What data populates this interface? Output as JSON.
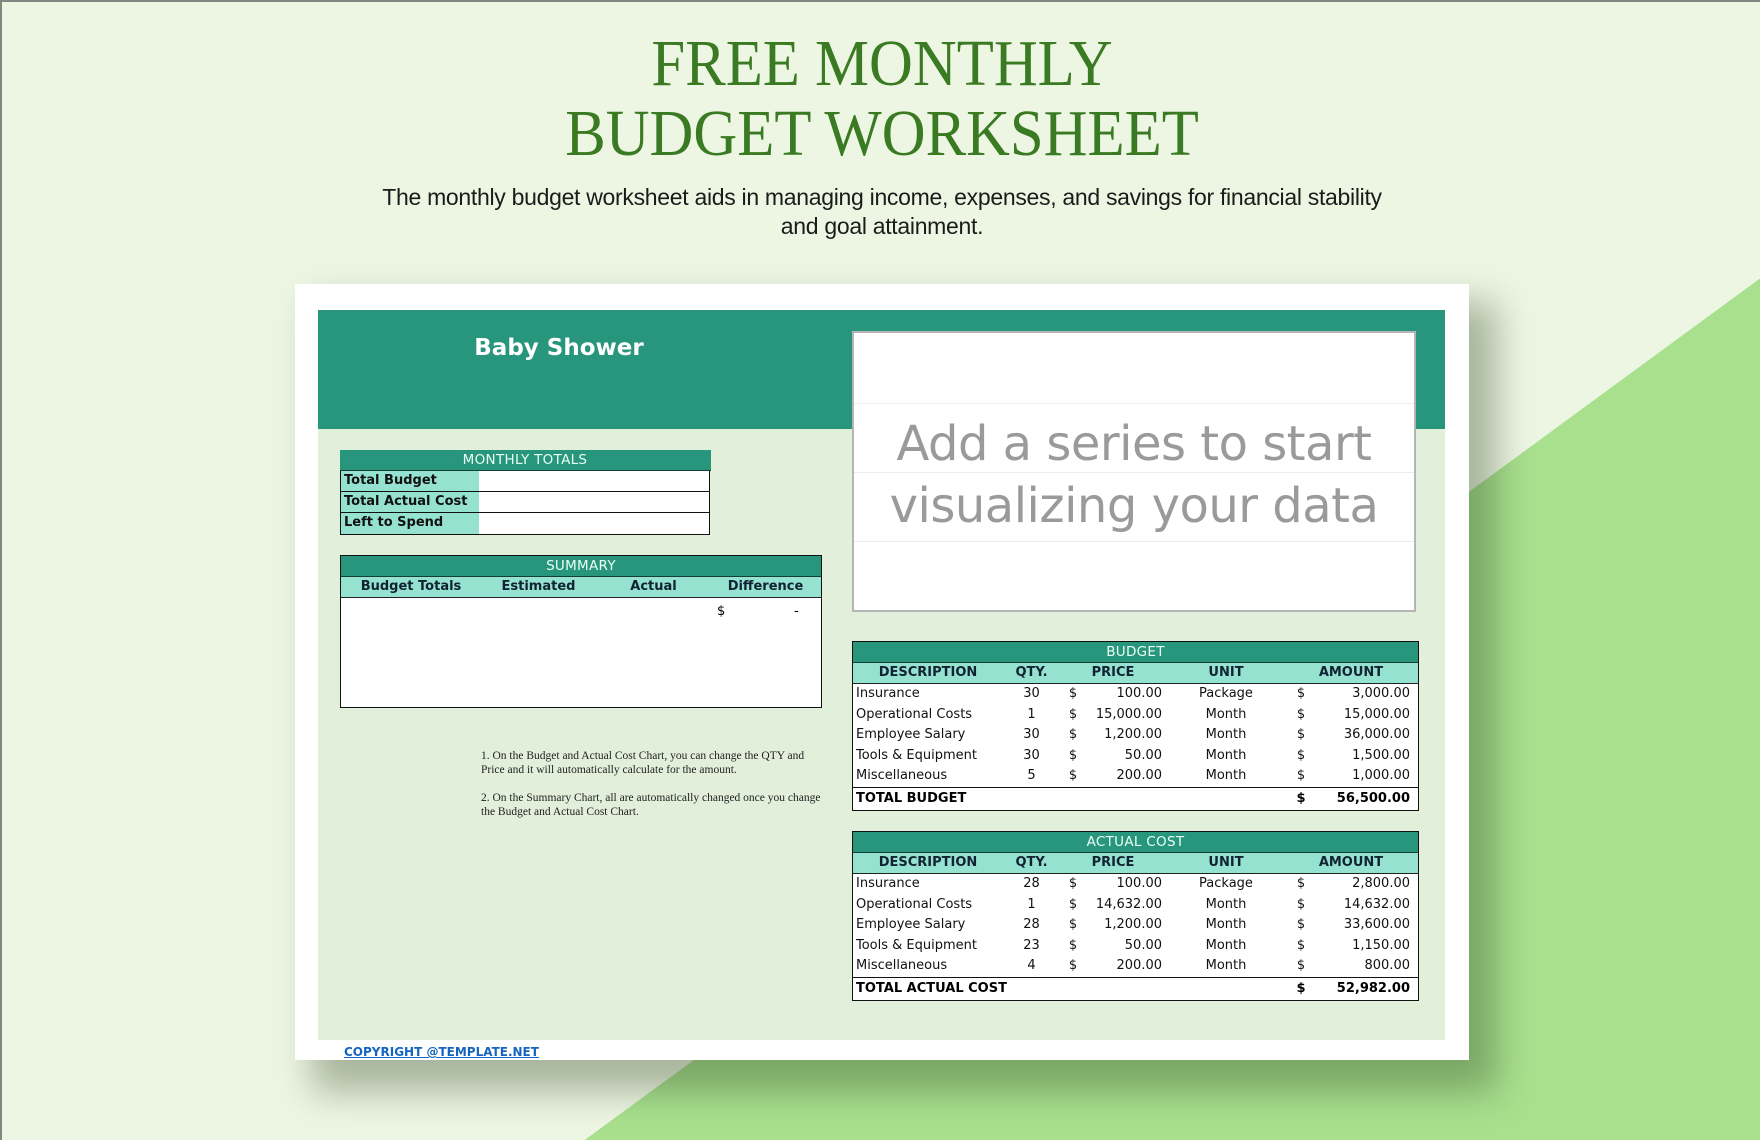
{
  "header": {
    "title_line1": "FREE MONTHLY",
    "title_line2": "BUDGET WORKSHEET",
    "subtitle": "The monthly budget worksheet aids in managing income, expenses, and savings for financial stability and goal attainment."
  },
  "sheet": {
    "title": "Baby Shower",
    "monthly_totals": {
      "caption": "MONTHLY TOTALS",
      "rows": [
        {
          "label": "Total Budget",
          "value": ""
        },
        {
          "label": "Total Actual Cost",
          "value": ""
        },
        {
          "label": "Left to Spend",
          "value": ""
        }
      ]
    },
    "summary": {
      "caption": "SUMMARY",
      "columns": [
        "Budget Totals",
        "Estimated",
        "Actual",
        "Difference"
      ],
      "difference_currency": "$",
      "difference_value": "-"
    },
    "notes": [
      "1. On the Budget and Actual Cost Chart, you can change the QTY and Price and it will automatically calculate for the amount.",
      "2. On the Summary Chart, all are automatically changed once you change the Budget and Actual Cost Chart."
    ],
    "chart_placeholder": {
      "line1": "Add a series to start",
      "line2": "visualizing your data"
    },
    "columns": [
      "DESCRIPTION",
      "QTY.",
      "PRICE",
      "UNIT",
      "AMOUNT"
    ],
    "budget": {
      "caption": "BUDGET",
      "rows": [
        {
          "desc": "Insurance",
          "qty": "30",
          "cur": "$",
          "price": "100.00",
          "unit": "Package",
          "amt_cur": "$",
          "amount": "3,000.00"
        },
        {
          "desc": "Operational Costs",
          "qty": "1",
          "cur": "$",
          "price": "15,000.00",
          "unit": "Month",
          "amt_cur": "$",
          "amount": "15,000.00"
        },
        {
          "desc": "Employee Salary",
          "qty": "30",
          "cur": "$",
          "price": "1,200.00",
          "unit": "Month",
          "amt_cur": "$",
          "amount": "36,000.00"
        },
        {
          "desc": "Tools & Equipment",
          "qty": "30",
          "cur": "$",
          "price": "50.00",
          "unit": "Month",
          "amt_cur": "$",
          "amount": "1,500.00"
        },
        {
          "desc": "Miscellaneous",
          "qty": "5",
          "cur": "$",
          "price": "200.00",
          "unit": "Month",
          "amt_cur": "$",
          "amount": "1,000.00"
        }
      ],
      "total_label": "TOTAL BUDGET",
      "total_cur": "$",
      "total_value": "56,500.00"
    },
    "actual": {
      "caption": "ACTUAL COST",
      "rows": [
        {
          "desc": "Insurance",
          "qty": "28",
          "cur": "$",
          "price": "100.00",
          "unit": "Package",
          "amt_cur": "$",
          "amount": "2,800.00"
        },
        {
          "desc": "Operational Costs",
          "qty": "1",
          "cur": "$",
          "price": "14,632.00",
          "unit": "Month",
          "amt_cur": "$",
          "amount": "14,632.00"
        },
        {
          "desc": "Employee Salary",
          "qty": "28",
          "cur": "$",
          "price": "1,200.00",
          "unit": "Month",
          "amt_cur": "$",
          "amount": "33,600.00"
        },
        {
          "desc": "Tools & Equipment",
          "qty": "23",
          "cur": "$",
          "price": "50.00",
          "unit": "Month",
          "amt_cur": "$",
          "amount": "1,150.00"
        },
        {
          "desc": "Miscellaneous",
          "qty": "4",
          "cur": "$",
          "price": "200.00",
          "unit": "Month",
          "amt_cur": "$",
          "amount": "800.00"
        }
      ],
      "total_label": "TOTAL ACTUAL COST",
      "total_cur": "$",
      "total_value": "52,982.00"
    },
    "copyright": "COPYRIGHT @TEMPLATE.NET"
  },
  "colors": {
    "background": "#edf6e3",
    "accent_triangle": "#a8e08e",
    "title_green": "#3a7a22",
    "teal": "#28967c",
    "mint": "#94e2cf",
    "sheet_bg": "#e2efdb",
    "link_blue": "#1565c0"
  }
}
